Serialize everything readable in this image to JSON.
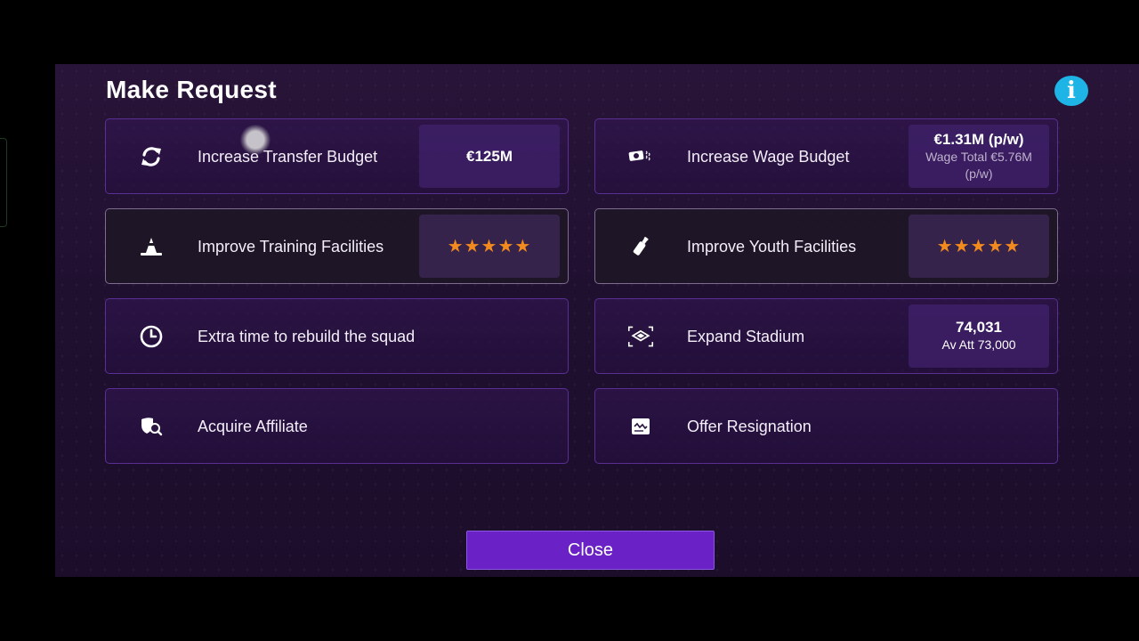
{
  "title": "Make Request",
  "info_icon": "i",
  "requests": {
    "transfer": {
      "label": "Increase Transfer Budget",
      "icon": "refresh-icon",
      "value": "€125M"
    },
    "wage": {
      "label": "Increase Wage Budget",
      "icon": "money-icon",
      "value": "€1.31M (p/w)",
      "sub": "Wage Total €5.76M (p/w)"
    },
    "training": {
      "label": "Improve Training Facilities",
      "icon": "cone-icon",
      "stars": "★★★★★",
      "rating": 5
    },
    "youth": {
      "label": "Improve Youth Facilities",
      "icon": "bottle-icon",
      "stars": "★★★★★",
      "rating": 5
    },
    "rebuild": {
      "label": "Extra time to rebuild the squad",
      "icon": "clock-icon"
    },
    "stadium": {
      "label": "Expand Stadium",
      "icon": "stadium-icon",
      "value": "74,031",
      "sub": "Av Att 73,000"
    },
    "affiliate": {
      "label": "Acquire Affiliate",
      "icon": "shield-search-icon"
    },
    "resign": {
      "label": "Offer Resignation",
      "icon": "document-icon"
    }
  },
  "close_label": "Close",
  "colors": {
    "accent": "#6a22c6",
    "star": "#f28a1e",
    "info": "#1fb4e6",
    "card_border": "#5a2f93"
  }
}
